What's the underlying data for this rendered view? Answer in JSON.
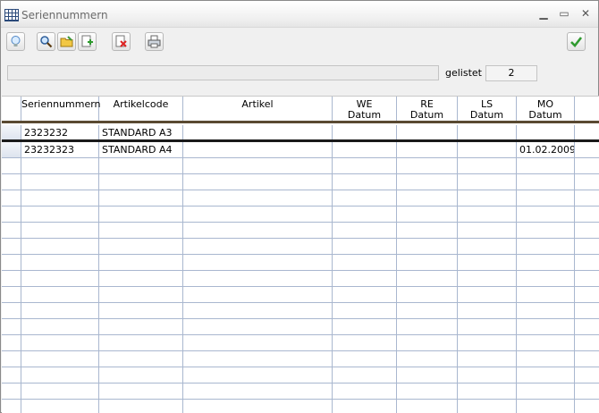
{
  "window": {
    "title": "Seriennummern"
  },
  "toolbar": {
    "buttons": [
      {
        "name": "hint-button",
        "icon": "lightbulb-icon"
      },
      {
        "name": "search-button",
        "icon": "magnifier-icon"
      },
      {
        "name": "open-button",
        "icon": "folder-icon"
      },
      {
        "name": "new-button",
        "icon": "new-document-icon"
      },
      {
        "name": "delete-button",
        "icon": "delete-document-icon"
      },
      {
        "name": "print-button",
        "icon": "printer-icon"
      },
      {
        "name": "confirm-button",
        "icon": "checkmark-icon"
      }
    ]
  },
  "filter": {
    "value": ""
  },
  "listed": {
    "label": "gelistet",
    "count": "2"
  },
  "table": {
    "columns": [
      {
        "key": "serial",
        "label": "Seriennummern",
        "sub": ""
      },
      {
        "key": "code",
        "label": "Artikelcode",
        "sub": ""
      },
      {
        "key": "article",
        "label": "Artikel",
        "sub": ""
      },
      {
        "key": "we",
        "label": "WE",
        "sub": "Datum"
      },
      {
        "key": "re",
        "label": "RE",
        "sub": "Datum"
      },
      {
        "key": "ls",
        "label": "LS",
        "sub": "Datum"
      },
      {
        "key": "mo",
        "label": "MO",
        "sub": "Datum"
      },
      {
        "key": "extra",
        "label": "",
        "sub": ""
      }
    ],
    "rows": [
      {
        "serial": "2323232",
        "code": "STANDARD A3",
        "article": "",
        "we": "",
        "re": "",
        "ls": "",
        "mo": "",
        "extra": ""
      },
      {
        "serial": "23232323",
        "code": "STANDARD A4",
        "article": "",
        "we": "",
        "re": "",
        "ls": "",
        "mo": "01.02.2009",
        "extra": ""
      }
    ]
  },
  "colors": {
    "accent": "#5a4a32",
    "gridline": "#a9b7cf"
  }
}
